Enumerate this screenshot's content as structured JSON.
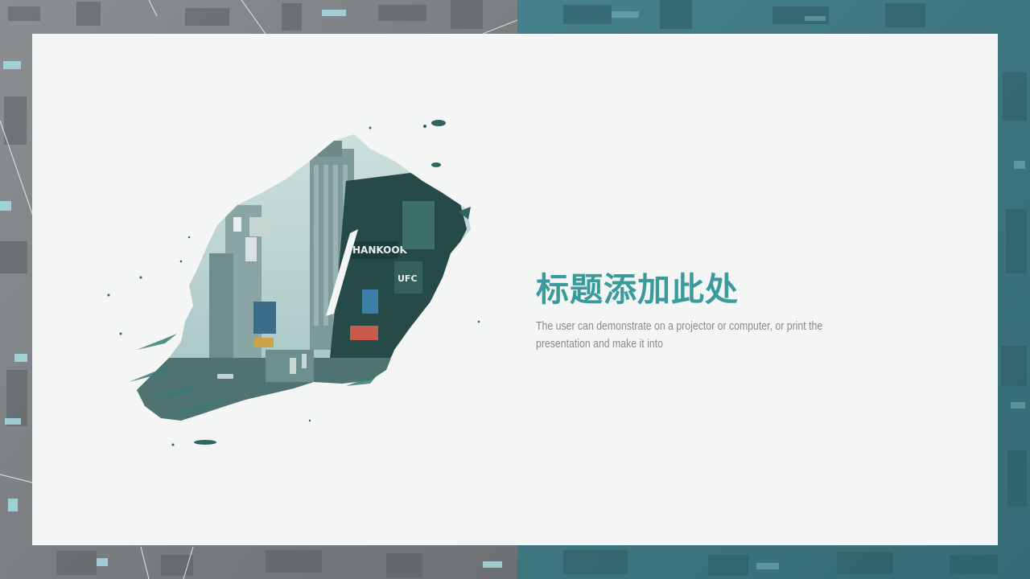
{
  "slide": {
    "title": "标题添加此处",
    "subtitle": "The user can demonstrate on a projector or computer, or print the presentation and make it into"
  },
  "colors": {
    "accent": "#3a9a9c",
    "card_background": "#f3f6f5",
    "text_muted": "#8a8a8a",
    "background_left": "#7a7e80",
    "background_right": "#3f7780"
  },
  "icons": {
    "city_brush_image": "city-street-brush-image"
  }
}
